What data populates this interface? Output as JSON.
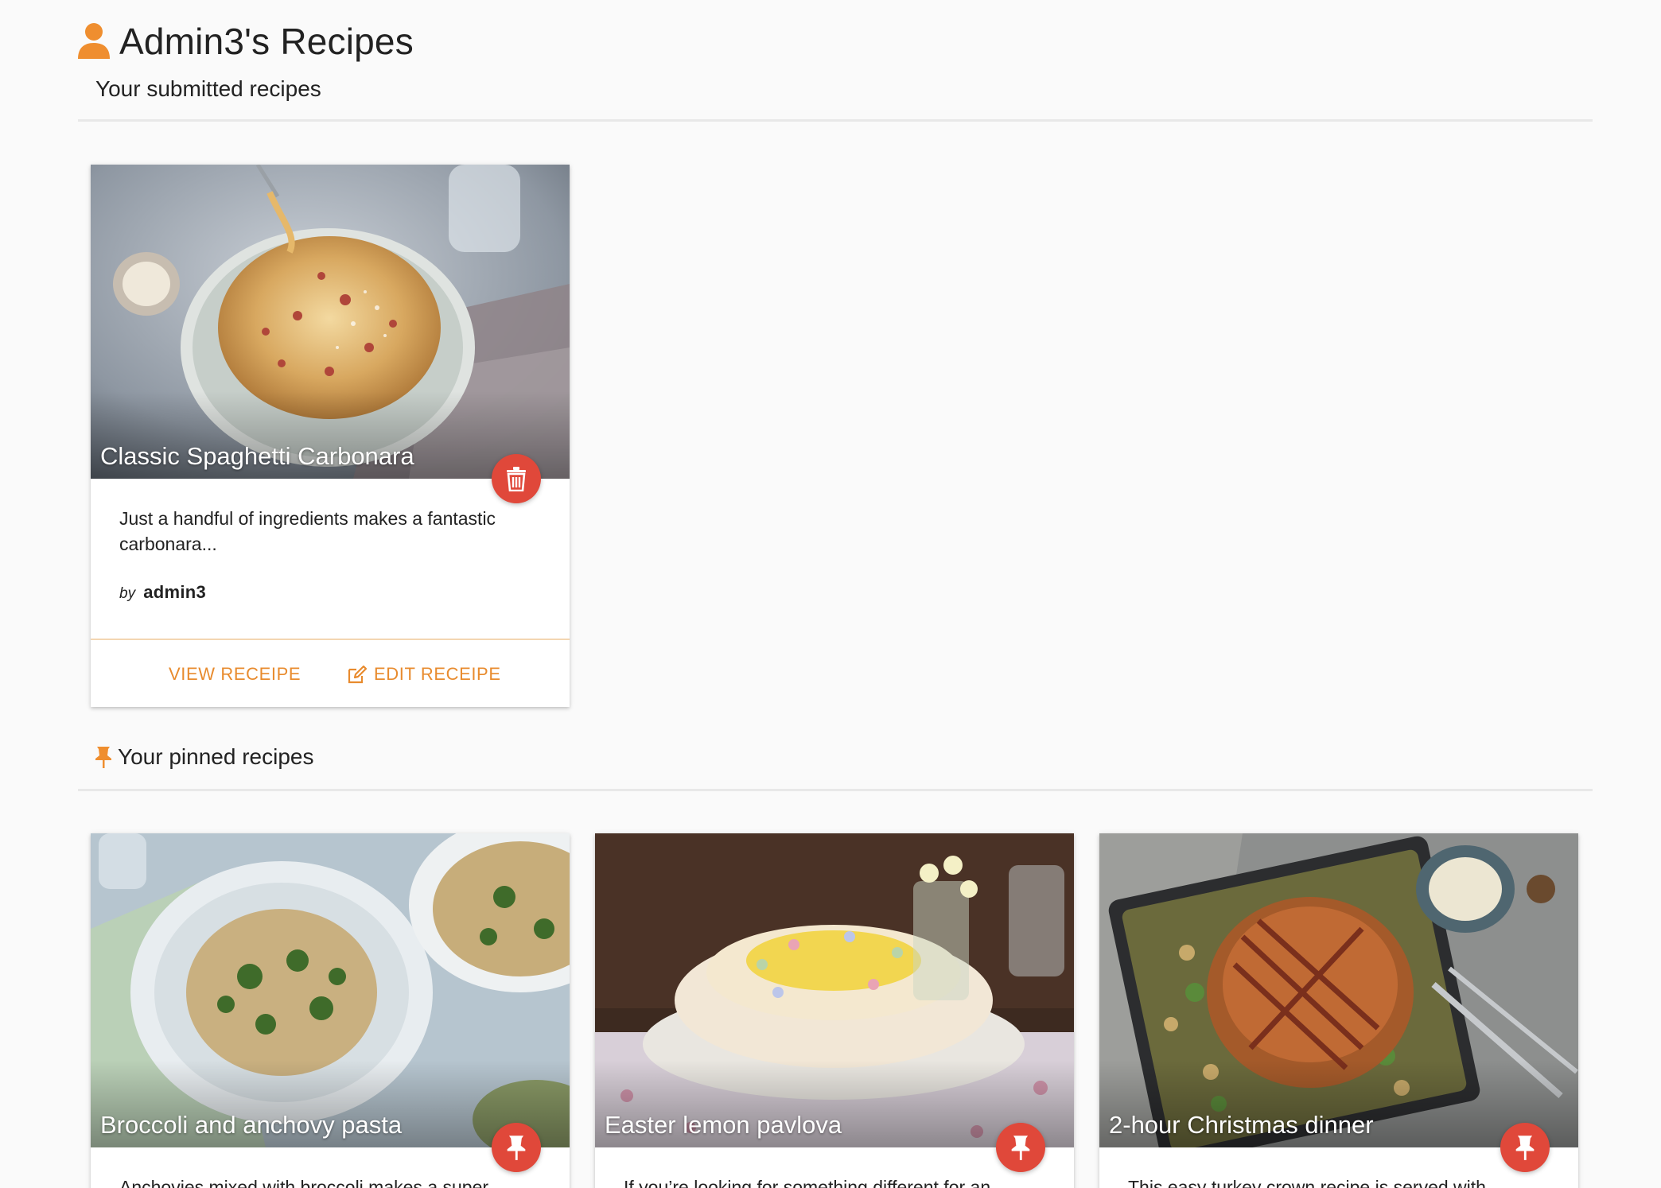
{
  "header": {
    "title": "Admin3's Recipes",
    "icon": "user-icon"
  },
  "submitted": {
    "heading": "Your submitted recipes",
    "cards": [
      {
        "title": "Classic Spaghetti Carbonara",
        "description": "Just a handful of ingredients makes a fantastic carbonara...",
        "by_label": "by",
        "author": "admin3",
        "view_label": "VIEW RECEIPE",
        "edit_label": "EDIT RECEIPE",
        "fab_icon": "trash-icon"
      }
    ]
  },
  "pinned": {
    "heading": "Your pinned recipes",
    "icon": "pin-icon",
    "cards": [
      {
        "title": "Broccoli and anchovy pasta",
        "description": "Anchovies mixed with broccoli makes a super quick, tasty pasta dish. If...",
        "fab_icon": "pin-icon"
      },
      {
        "title": "Easter lemon pavlova",
        "description": "If you’re looking for something different for an Easter dessert, this...",
        "fab_icon": "pin-icon"
      },
      {
        "title": "2-hour Christmas dinner",
        "description": "This easy turkey crown recipe is served with shortcut sides to make...",
        "fab_icon": "pin-icon"
      }
    ]
  },
  "colors": {
    "accent": "#e88b2e",
    "fab": "#e0483a",
    "background": "#fafafa"
  }
}
